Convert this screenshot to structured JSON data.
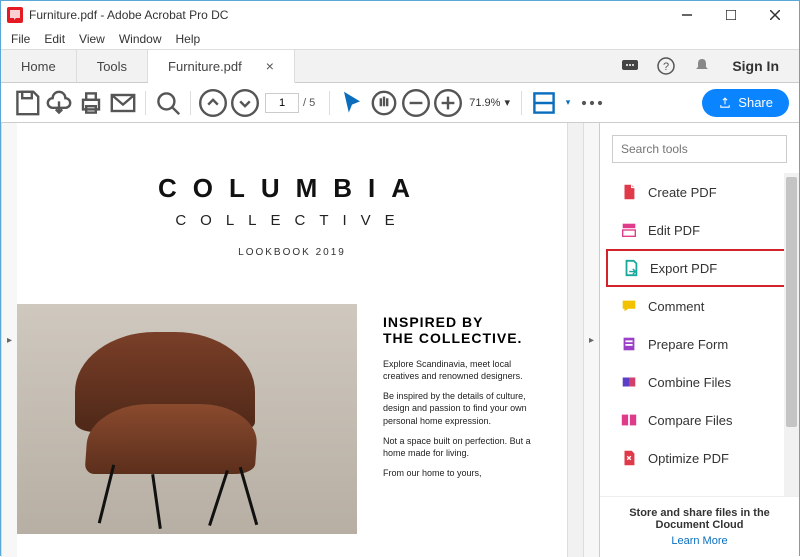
{
  "titlebar": {
    "title": "Furniture.pdf - Adobe Acrobat Pro DC"
  },
  "menu": {
    "file": "File",
    "edit": "Edit",
    "view": "View",
    "window": "Window",
    "help": "Help"
  },
  "tabs": {
    "home": "Home",
    "tools": "Tools",
    "doc": "Furniture.pdf"
  },
  "signin": "Sign In",
  "toolbar": {
    "page_current": "1",
    "page_total": "/ 5",
    "zoom": "71.9%",
    "share": "Share"
  },
  "search": {
    "placeholder": "Search tools"
  },
  "tools": {
    "create": "Create PDF",
    "edit": "Edit PDF",
    "export": "Export PDF",
    "comment": "Comment",
    "prepare": "Prepare Form",
    "combine": "Combine Files",
    "compare": "Compare Files",
    "optimize": "Optimize PDF"
  },
  "promo": {
    "line1": "Store and share files in the",
    "line2": "Document Cloud",
    "learn": "Learn More"
  },
  "doc": {
    "brand1": "COLUMBIA",
    "brand2": "COLLECTIVE",
    "lookbook": "LOOKBOOK 2019",
    "h1": "INSPIRED BY",
    "h2": "THE COLLECTIVE.",
    "p1": "Explore Scandinavia, meet local creatives and renowned designers.",
    "p2": "Be inspired by the details of culture, design and passion to find your own personal home expression.",
    "p3": "Not a space built on perfection. But a home made for living.",
    "p4": "From our home to yours,"
  }
}
